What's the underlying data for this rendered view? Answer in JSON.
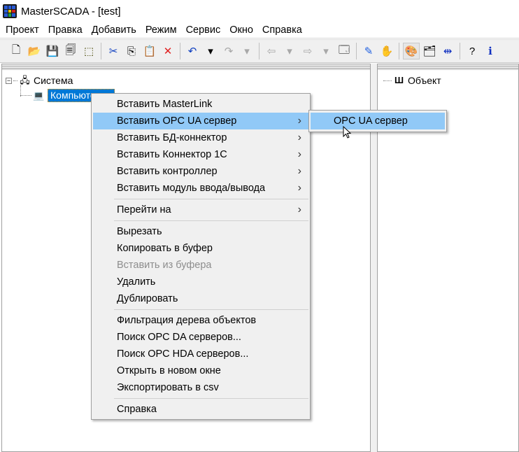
{
  "window": {
    "title": "MasterSCADA - [test]",
    "app_icon": "masterscada-grid-icon"
  },
  "menubar": [
    "Проект",
    "Правка",
    "Добавить",
    "Режим",
    "Сервис",
    "Окно",
    "Справка"
  ],
  "toolbar": [
    {
      "icon": "new-file-icon",
      "glyph": "🗋"
    },
    {
      "icon": "open-folder-icon",
      "glyph": "📂"
    },
    {
      "icon": "save-icon",
      "glyph": "💾"
    },
    {
      "icon": "save-all-icon",
      "glyph": "🗐"
    },
    {
      "icon": "export-icon",
      "glyph": "⬚"
    },
    {
      "sep": true
    },
    {
      "icon": "cut-icon",
      "glyph": "✂"
    },
    {
      "icon": "copy-icon",
      "glyph": "⎘"
    },
    {
      "icon": "paste-icon",
      "glyph": "📋",
      "disabled": true
    },
    {
      "icon": "delete-icon",
      "glyph": "✕"
    },
    {
      "sep": true
    },
    {
      "icon": "undo-icon",
      "glyph": "↶"
    },
    {
      "icon": "undo-dropdown-icon",
      "glyph": "▾"
    },
    {
      "icon": "redo-icon",
      "glyph": "↷",
      "disabled": true
    },
    {
      "icon": "redo-dropdown-icon",
      "glyph": "▾",
      "disabled": true
    },
    {
      "sep": true
    },
    {
      "icon": "back-icon",
      "glyph": "⇦",
      "disabled": true
    },
    {
      "icon": "back-dropdown-icon",
      "glyph": "▾",
      "disabled": true
    },
    {
      "icon": "forward-icon",
      "glyph": "⇨",
      "disabled": true
    },
    {
      "icon": "forward-dropdown-icon",
      "glyph": "▾",
      "disabled": true
    },
    {
      "icon": "window-icon",
      "glyph": "🗔"
    },
    {
      "sep": true
    },
    {
      "icon": "pen-icon",
      "glyph": "✎"
    },
    {
      "icon": "hand-icon",
      "glyph": "✋"
    },
    {
      "sep": true
    },
    {
      "icon": "palette-icon",
      "glyph": "🎨",
      "pressed": true
    },
    {
      "icon": "project-folder-icon",
      "glyph": "🗂"
    },
    {
      "icon": "connect-icon",
      "glyph": "⇹"
    },
    {
      "sep": true
    },
    {
      "icon": "help-pointer-icon",
      "glyph": "?"
    },
    {
      "icon": "info-icon",
      "glyph": "ℹ"
    }
  ],
  "tree": {
    "root": "Система",
    "child": "Компьютер"
  },
  "right_tree": {
    "root": "Объект"
  },
  "context_menu": {
    "items": [
      {
        "label": "Вставить MasterLink"
      },
      {
        "label": "Вставить OPC UA сервер",
        "submenu": true,
        "highlighted": true
      },
      {
        "label": "Вставить БД-коннектор",
        "submenu": true
      },
      {
        "label": "Вставить Коннектор 1С",
        "submenu": true
      },
      {
        "label": "Вставить контроллер",
        "submenu": true
      },
      {
        "label": "Вставить модуль ввода/вывода",
        "submenu": true
      },
      {
        "separator": true
      },
      {
        "label": "Перейти на",
        "submenu": true
      },
      {
        "separator": true
      },
      {
        "label": "Вырезать"
      },
      {
        "label": "Копировать в буфер"
      },
      {
        "label": "Вставить из буфера",
        "disabled": true
      },
      {
        "label": "Удалить"
      },
      {
        "label": "Дублировать"
      },
      {
        "separator": true
      },
      {
        "label": "Фильтрация дерева объектов"
      },
      {
        "label": "Поиск OPC DA серверов..."
      },
      {
        "label": "Поиск OPC HDA серверов..."
      },
      {
        "label": "Открыть в новом окне"
      },
      {
        "label": "Экспортировать в csv"
      },
      {
        "separator": true
      },
      {
        "label": "Справка"
      }
    ],
    "submenu": {
      "label": "OPC UA сервер"
    }
  },
  "colors": {
    "highlight": "#91c9f7",
    "selection": "#0078d7"
  }
}
